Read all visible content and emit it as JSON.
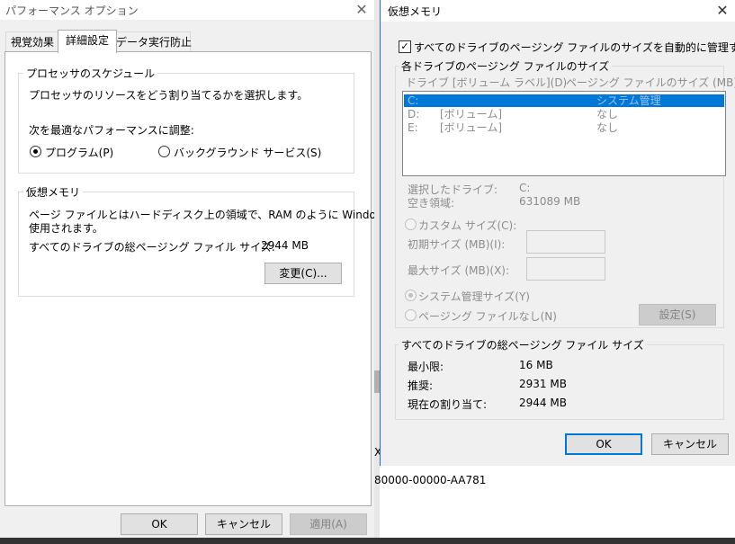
{
  "perf": {
    "title": "パフォーマンス オプション",
    "close_glyph": "✕",
    "tabs": [
      "視覚効果",
      "詳細設定",
      "データ実行防止"
    ],
    "scheduling": {
      "legend": "プロセッサのスケジュール",
      "desc": "プロセッサのリソースをどう割り当てるかを選択します。",
      "adjust_label": "次を最適なパフォーマンスに調整:",
      "opt_programs": "プログラム(P)",
      "opt_background": "バックグラウンド サービス(S)"
    },
    "vm": {
      "legend": "仮想メモリ",
      "desc_line1": "ページ ファイルとはハードディスク上の領域で、RAM のように Windows で",
      "desc_line2": "使用されます。",
      "total_label": "すべてのドライブの総ページング ファイル サイズ:",
      "total_value": "2944 MB",
      "change_button": "変更(C)..."
    },
    "buttons": {
      "ok": "OK",
      "cancel": "キャンセル",
      "apply": "適用(A)"
    }
  },
  "behind": {
    "text": "80000-00000-AA781",
    "glyph": "X"
  },
  "vm_dialog": {
    "title": "仮想メモリ",
    "close_glyph": "✕",
    "auto_manage": "すべてのドライブのページング ファイルのサイズを自動的に管理する(A)",
    "auto_manage_checked": true,
    "per_drive": {
      "legend": "各ドライブのページング ファイルのサイズ",
      "col_drive": "ドライブ [ボリューム ラベル](D)",
      "col_size": "ページング ファイルのサイズ (MB)",
      "rows": [
        {
          "drive": "C:",
          "label": "",
          "size": "システム管理"
        },
        {
          "drive": "D:",
          "label": "[ボリューム]",
          "size": "なし"
        },
        {
          "drive": "E:",
          "label": "[ボリューム]",
          "size": "なし"
        }
      ],
      "selected_drive_label": "選択したドライブ:",
      "selected_drive_value": "C:",
      "free_space_label": "空き領域:",
      "free_space_value": "631089 MB",
      "custom_size": "カスタム サイズ(C):",
      "initial_size": "初期サイズ (MB)(I):",
      "max_size": "最大サイズ (MB)(X):",
      "system_managed": "システム管理サイズ(Y)",
      "no_paging": "ページング ファイルなし(N)",
      "set_button": "設定(S)"
    },
    "total": {
      "legend": "すべてのドライブの総ページング ファイル サイズ",
      "min_label": "最小限:",
      "min_value": "16 MB",
      "recommended_label": "推奨:",
      "recommended_value": "2931 MB",
      "current_label": "現在の割り当て:",
      "current_value": "2944 MB"
    },
    "buttons": {
      "ok": "OK",
      "cancel": "キャンセル"
    }
  },
  "colors": {
    "accent": "#0078d7",
    "disabled_text": "#8c8c8c"
  }
}
